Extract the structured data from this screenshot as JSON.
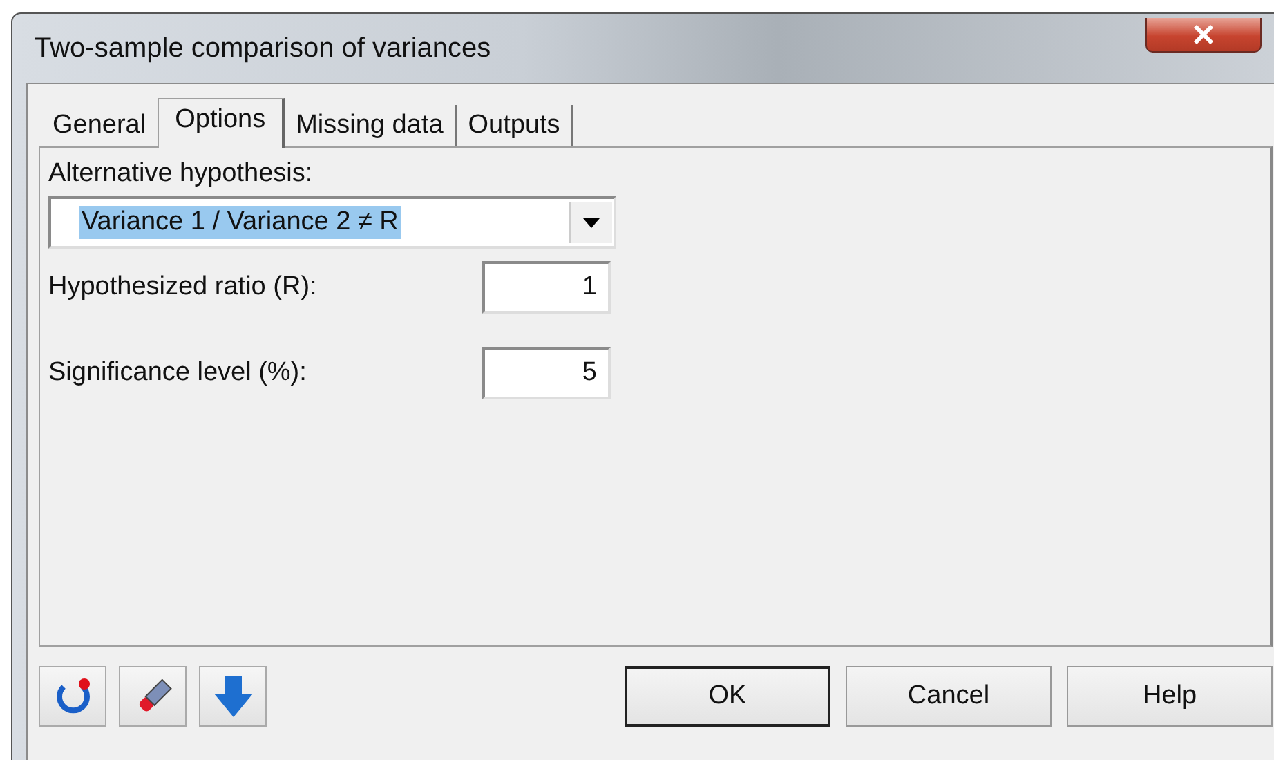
{
  "window": {
    "title": "Two-sample comparison of variances"
  },
  "tabs": [
    {
      "label": "General",
      "selected": false
    },
    {
      "label": "Options",
      "selected": true
    },
    {
      "label": "Missing data",
      "selected": false
    },
    {
      "label": "Outputs",
      "selected": false
    }
  ],
  "alternative_hypothesis": {
    "label": "Alternative hypothesis:",
    "value": "Variance 1 / Variance 2 ≠ R",
    "highlighted": true
  },
  "fields": [
    {
      "label": "Hypothesized ratio (R):",
      "value": "1"
    },
    {
      "label": "Significance level (%):",
      "value": "5"
    }
  ],
  "buttons": [
    {
      "label": "OK",
      "default": true
    },
    {
      "label": "Cancel",
      "default": false
    },
    {
      "label": "Help",
      "default": false
    }
  ]
}
